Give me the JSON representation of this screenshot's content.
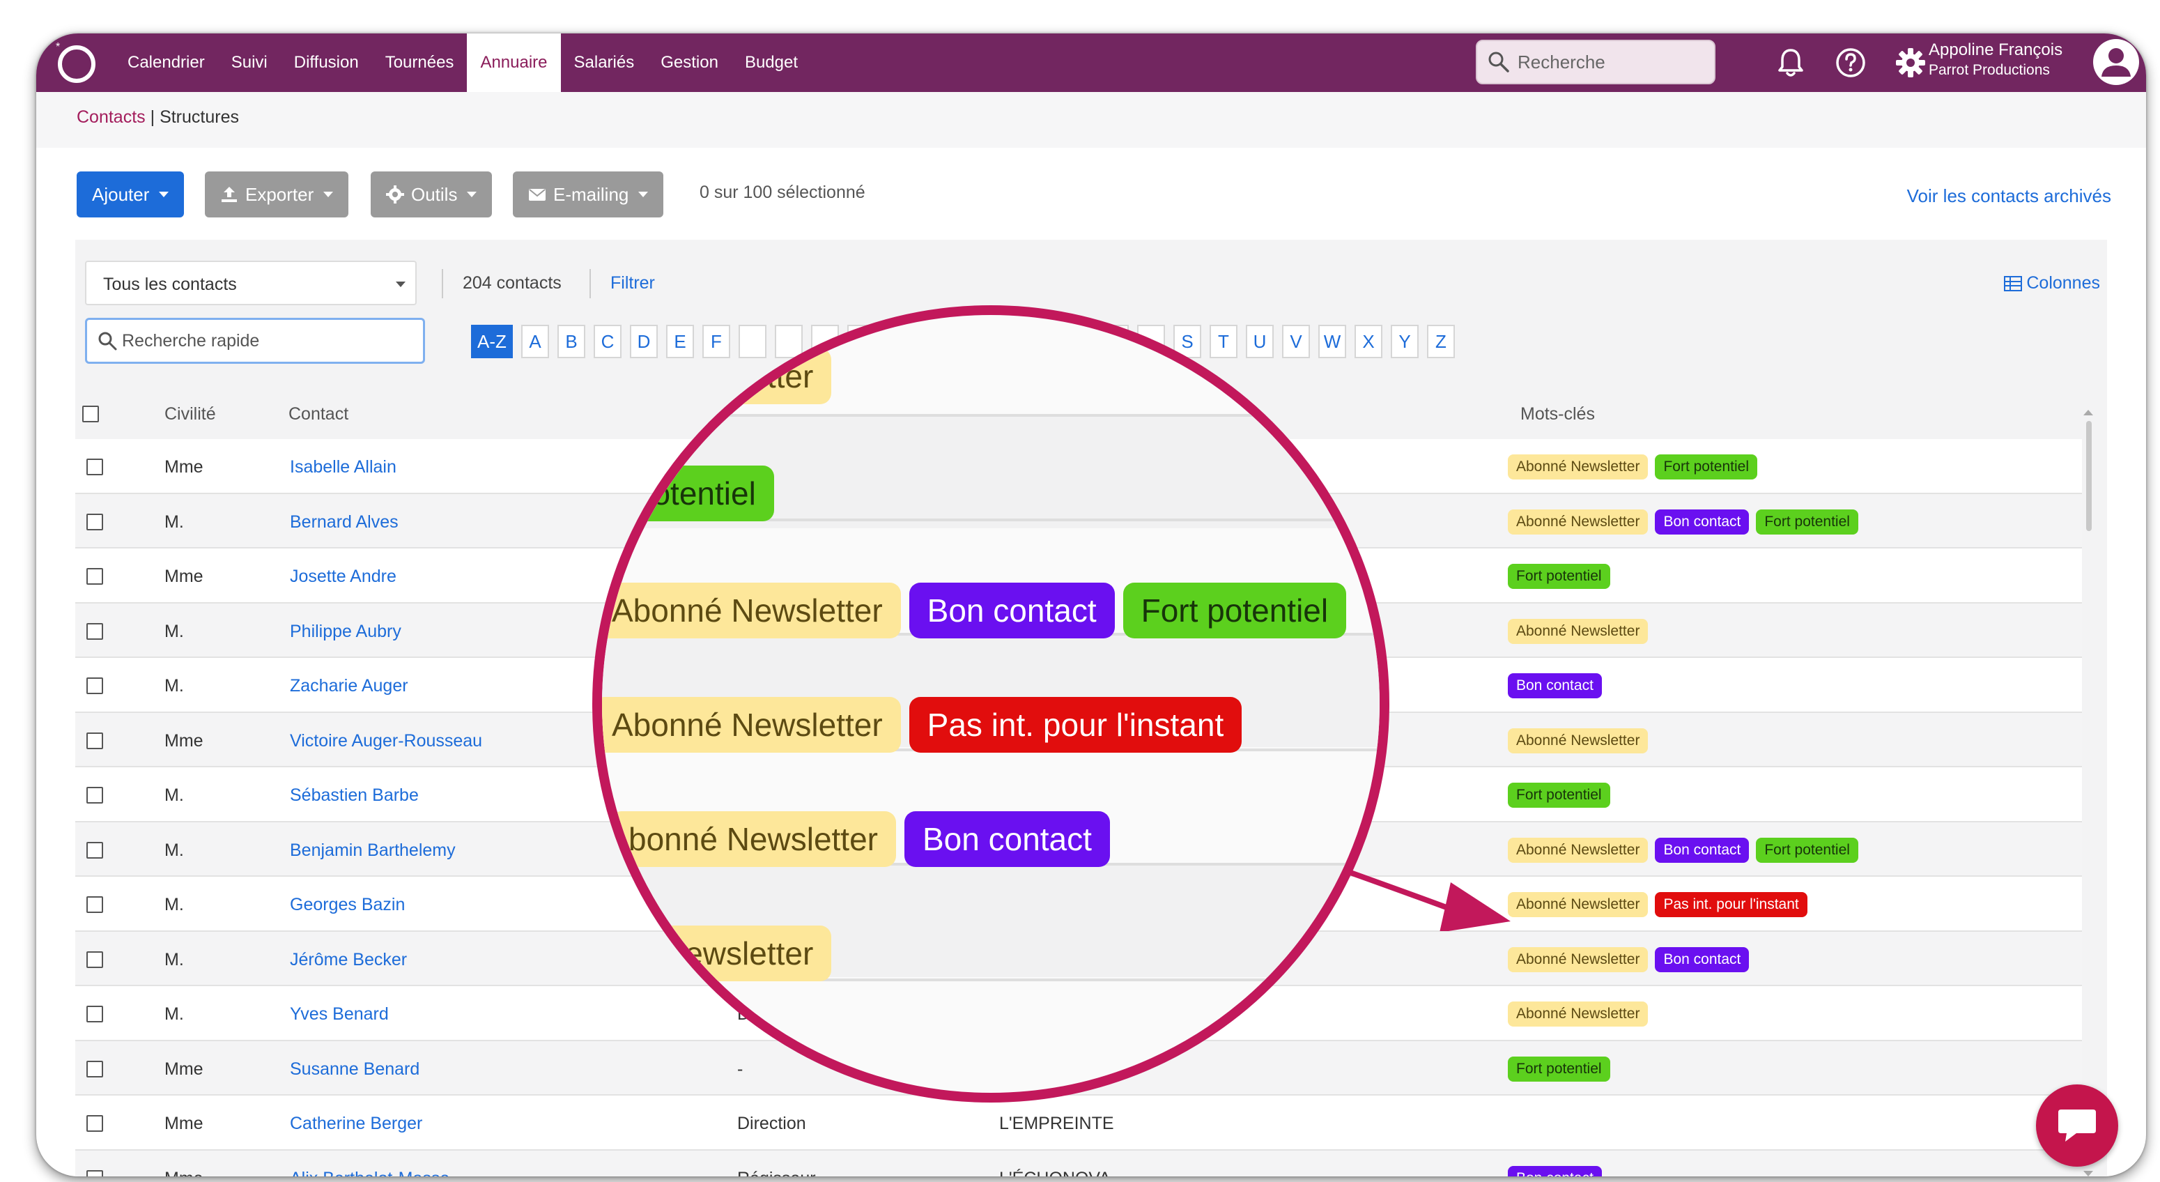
{
  "nav": {
    "items": [
      "Calendrier",
      "Suivi",
      "Diffusion",
      "Tournées",
      "Annuaire",
      "Salariés",
      "Gestion",
      "Budget"
    ],
    "active": "Annuaire",
    "search_placeholder": "Recherche"
  },
  "user": {
    "name": "Appoline François",
    "company": "Parrot Productions"
  },
  "breadcrumb": {
    "contacts": "Contacts",
    "separator": " | ",
    "structures": "Structures"
  },
  "toolbar": {
    "add": "Ajouter",
    "export": "Exporter",
    "tools": "Outils",
    "emailing": "E-mailing",
    "selection": "0 sur 100 sélectionné",
    "archived": "Voir les contacts archivés"
  },
  "filter": {
    "view": "Tous les contacts",
    "count": "204 contacts",
    "filter_link": "Filtrer",
    "columns": "Colonnes",
    "quick_search_placeholder": "Recherche rapide",
    "letters": [
      "A-Z",
      "A",
      "B",
      "C",
      "D",
      "E",
      "F",
      "",
      "",
      "",
      "",
      "",
      "",
      "",
      "",
      "",
      "",
      "",
      "",
      "S",
      "T",
      "U",
      "V",
      "W",
      "X",
      "Y",
      "Z"
    ]
  },
  "table": {
    "headers": {
      "civility": "Civilité",
      "contact": "Contact",
      "keywords": "Mots-clés"
    },
    "rows": [
      {
        "civ": "Mme",
        "name": "Isabelle Allain",
        "fn": "",
        "st": "",
        "tags": [
          "Abonné Newsletter",
          "Fort potentiel"
        ]
      },
      {
        "civ": "M.",
        "name": "Bernard Alves",
        "fn": "",
        "st": "",
        "tags": [
          "Abonné Newsletter",
          "Bon contact",
          "Fort potentiel"
        ]
      },
      {
        "civ": "Mme",
        "name": "Josette Andre",
        "fn": "",
        "st": "",
        "tags": [
          "Fort potentiel"
        ]
      },
      {
        "civ": "M.",
        "name": "Philippe Aubry",
        "fn": "",
        "st": "",
        "tags": [
          "Abonné Newsletter"
        ]
      },
      {
        "civ": "M.",
        "name": "Zacharie Auger",
        "fn": "",
        "st": "",
        "tags": [
          "Bon contact"
        ]
      },
      {
        "civ": "Mme",
        "name": "Victoire Auger-Rousseau",
        "fn": "",
        "st": "",
        "tags": [
          "Abonné Newsletter"
        ]
      },
      {
        "civ": "M.",
        "name": "Sébastien Barbe",
        "fn": "",
        "st": "",
        "tags": [
          "Fort potentiel"
        ]
      },
      {
        "civ": "M.",
        "name": "Benjamin Barthelemy",
        "fn": "",
        "st": "",
        "tags": [
          "Abonné Newsletter",
          "Bon contact",
          "Fort potentiel"
        ]
      },
      {
        "civ": "M.",
        "name": "Georges Bazin",
        "fn": "",
        "st": "",
        "tags": [
          "Abonné Newsletter",
          "Pas int. pour l'instant"
        ]
      },
      {
        "civ": "M.",
        "name": "Jérôme Becker",
        "fn": "",
        "st": "",
        "tags": [
          "Abonné Newsletter",
          "Bon contact"
        ]
      },
      {
        "civ": "M.",
        "name": "Yves Benard",
        "fn": "Di",
        "st": "",
        "tags": [
          "Abonné Newsletter"
        ]
      },
      {
        "civ": "Mme",
        "name": "Susanne Benard",
        "fn": "-",
        "st": "",
        "tags": [
          "Fort potentiel"
        ]
      },
      {
        "civ": "Mme",
        "name": "Catherine Berger",
        "fn": "Direction",
        "st": "L'EMPREINTE",
        "tags": []
      },
      {
        "civ": "Mme",
        "name": "Alix Berthelot-Masse",
        "fn": "Régisseur",
        "st": "L'ÉCHONOVA",
        "tags": [
          "Bon contact"
        ]
      }
    ]
  },
  "lens": {
    "rows": [
      [
        "Newsletter"
      ],
      [
        "rt potentiel"
      ],
      [
        "Abonné Newsletter",
        "Bon contact",
        "Fort potentiel"
      ],
      [
        "Abonné Newsletter",
        "Pas int. pour l'instant"
      ],
      [
        "bonné Newsletter",
        "Bon contact"
      ],
      [
        "Newsletter"
      ]
    ]
  },
  "colors": {
    "brand": "#722660",
    "accent": "#1d6cd9",
    "lens_border": "#c2185b",
    "tag_abonne": "#fde79a",
    "tag_bon": "#6a10f0",
    "tag_fort": "#5cd01e",
    "tag_pas": "#e10d0d"
  }
}
